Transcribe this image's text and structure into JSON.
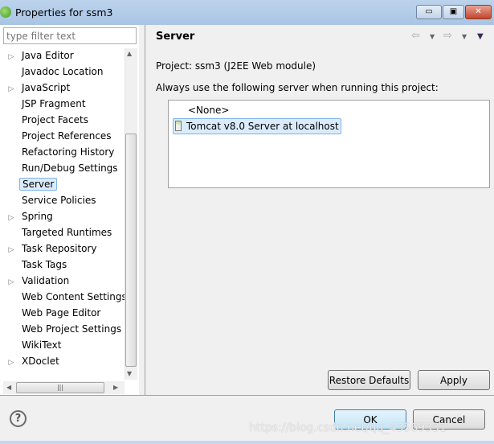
{
  "window": {
    "title": "Properties for ssm3",
    "minimize": "▭",
    "maximize": "▣",
    "close": "✕"
  },
  "filter": {
    "placeholder": "type filter text"
  },
  "tree": [
    {
      "label": "Java Editor",
      "expandable": true
    },
    {
      "label": "Javadoc Location",
      "expandable": false
    },
    {
      "label": "JavaScript",
      "expandable": true
    },
    {
      "label": "JSP Fragment",
      "expandable": false
    },
    {
      "label": "Project Facets",
      "expandable": false
    },
    {
      "label": "Project References",
      "expandable": false
    },
    {
      "label": "Refactoring History",
      "expandable": false
    },
    {
      "label": "Run/Debug Settings",
      "expandable": false
    },
    {
      "label": "Server",
      "expandable": false,
      "selected": true
    },
    {
      "label": "Service Policies",
      "expandable": false
    },
    {
      "label": "Spring",
      "expandable": true
    },
    {
      "label": "Targeted Runtimes",
      "expandable": false
    },
    {
      "label": "Task Repository",
      "expandable": true
    },
    {
      "label": "Task Tags",
      "expandable": false
    },
    {
      "label": "Validation",
      "expandable": true
    },
    {
      "label": "Web Content Settings",
      "expandable": false
    },
    {
      "label": "Web Page Editor",
      "expandable": false
    },
    {
      "label": "Web Project Settings",
      "expandable": false
    },
    {
      "label": "WikiText",
      "expandable": false
    },
    {
      "label": "XDoclet",
      "expandable": true
    }
  ],
  "page": {
    "title": "Server",
    "project": "Project: ssm3 (J2EE Web module)",
    "instruction": "Always use the following server when running this project:",
    "servers": [
      {
        "label": "<None>",
        "selected": false
      },
      {
        "label": "Tomcat v8.0 Server at localhost",
        "selected": true
      }
    ],
    "restore_defaults": "Restore Defaults",
    "apply": "Apply"
  },
  "footer": {
    "help": "?",
    "ok": "OK",
    "cancel": "Cancel"
  },
  "watermark": "https://blog.csdn.net/qq_43569331"
}
